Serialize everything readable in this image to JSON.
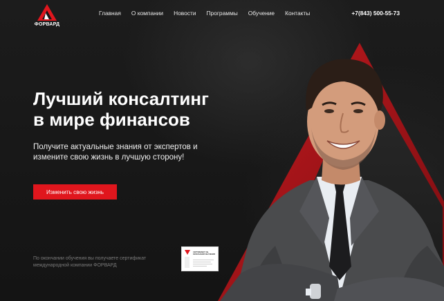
{
  "header": {
    "logo_text": "ФОРВАРД",
    "nav": [
      "Главная",
      "О компании",
      "Новости",
      "Программы",
      "Обучение",
      "Контакты"
    ],
    "phone": "+7(843) 500-55-73"
  },
  "hero": {
    "title_line1": "Лучший консалтинг",
    "title_line2": "в мире финансов",
    "subtitle_line1": "Получите актуальные знания от экспертов и",
    "subtitle_line2": "измените свою жизнь в лучшую сторону!",
    "cta_label": "Изменить свою жизнь"
  },
  "certificate": {
    "text_line1": "По окончании обучения вы получаете сертификат",
    "text_line2": "международной компании ФОРВАРД",
    "card_title": "СЕРТИФИКАТ ОБ ОКОНЧАНИИ ОБУЧЕНИЯ"
  },
  "colors": {
    "accent": "#e0161d",
    "background": "#161616",
    "suit": "#4a4b4d",
    "shirt": "#e9edf2"
  },
  "icons": {
    "logo": "triangle-a-logo-icon",
    "certificate": "certificate-icon",
    "person": "smiling-man-in-suit"
  }
}
